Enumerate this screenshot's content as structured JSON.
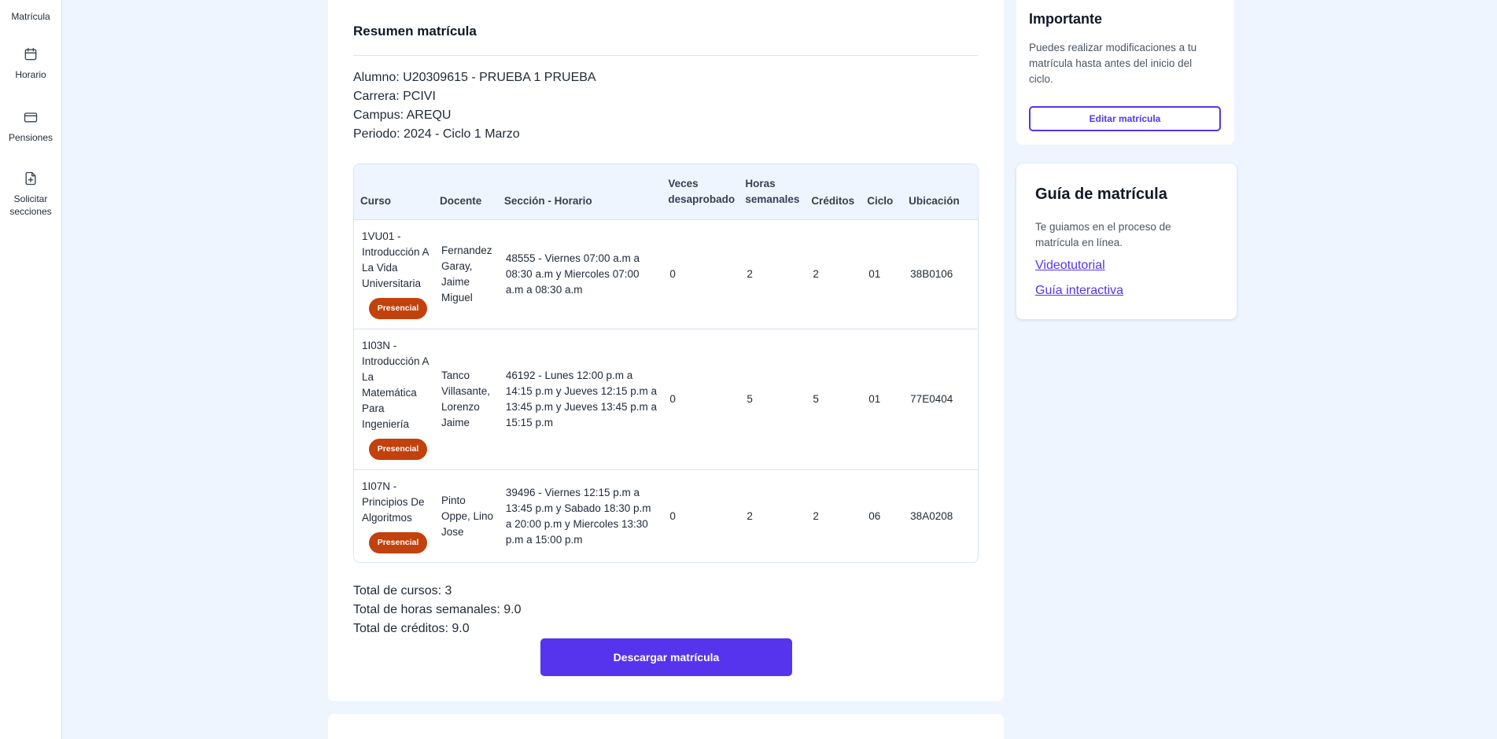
{
  "sidebar": {
    "items": [
      {
        "label": "Matrícula",
        "icon": "enrollment-icon"
      },
      {
        "label": "Horario",
        "icon": "calendar-icon"
      },
      {
        "label": "Pensiones",
        "icon": "credit-card-icon"
      },
      {
        "label": "Solicitar secciones",
        "icon": "file-plus-icon"
      }
    ]
  },
  "summary": {
    "title": "Resumen matrícula",
    "alumno": "Alumno: U20309615 - PRUEBA 1 PRUEBA",
    "carrera": "Carrera: PCIVI",
    "campus": "Campus: AREQU",
    "periodo": "Periodo: 2024 - Ciclo 1 Marzo"
  },
  "table": {
    "headers": [
      "Curso",
      "Docente",
      "Sección - Horario",
      "Veces desaprobado",
      "Horas semanales",
      "Créditos",
      "Ciclo",
      "Ubicación"
    ],
    "rows": [
      {
        "curso": "1VU01 - Introducción A La Vida Universitaria",
        "modalidad": "Presencial",
        "docente": "Fernandez Garay, Jaime Miguel",
        "seccion": "48555 - Viernes 07:00 a.m a 08:30 a.m y Miercoles 07:00 a.m a 08:30 a.m",
        "veces": "0",
        "horas": "2",
        "creditos": "2",
        "ciclo": "01",
        "ubicacion": "38B0106"
      },
      {
        "curso": "1I03N - Introducción A La Matemática Para Ingeniería",
        "modalidad": "Presencial",
        "docente": "Tanco Villasante, Lorenzo Jaime",
        "seccion": "46192 - Lunes 12:00 p.m a 14:15 p.m y Jueves 12:15 p.m a 13:45 p.m y Jueves 13:45 p.m a 15:15 p.m",
        "veces": "0",
        "horas": "5",
        "creditos": "5",
        "ciclo": "01",
        "ubicacion": "77E0404"
      },
      {
        "curso": "1I07N - Principios De Algoritmos",
        "modalidad": "Presencial",
        "docente": "Pinto Oppe, Lino Jose",
        "seccion": "39496 - Viernes 12:15 p.m a 13:45 p.m y Sabado 18:30 p.m a 20:00 p.m y Miercoles 13:30 p.m a 15:00 p.m",
        "veces": "0",
        "horas": "2",
        "creditos": "2",
        "ciclo": "06",
        "ubicacion": "38A0208"
      }
    ]
  },
  "totals": {
    "cursos": "Total de cursos: 3",
    "horas": "Total de horas semanales: 9.0",
    "creditos": "Total de créditos: 9.0"
  },
  "download_label": "Descargar matrícula",
  "important": {
    "title": "Importante",
    "text": "Puedes realizar modificaciones a tu matrícula hasta antes del inicio del ciclo.",
    "button": "Editar matrícula"
  },
  "guide": {
    "title": "Guía de matrícula",
    "text": "Te guiamos en el proceso de matrícula en línea.",
    "link1": "Videotutorial",
    "link2": "Guía interactiva"
  },
  "colors": {
    "primary": "#5634ee",
    "badge": "#c2410c",
    "background": "#eef5ff"
  }
}
